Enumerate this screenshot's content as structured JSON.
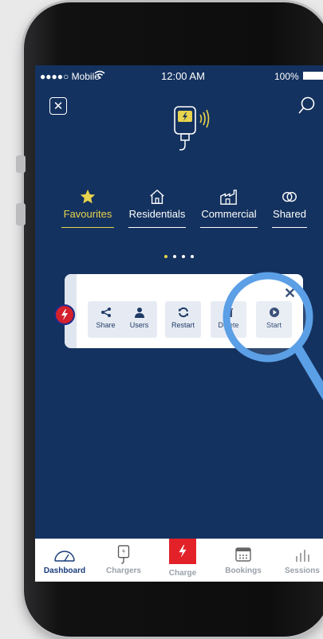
{
  "status_bar": {
    "carrier": "●●●●○ Mobile",
    "time": "12:00 AM",
    "battery": "100%"
  },
  "tabs": [
    {
      "label": "Favourites",
      "icon": "star-icon",
      "active": true
    },
    {
      "label": "Residentials",
      "icon": "house-icon",
      "active": false
    },
    {
      "label": "Commercial",
      "icon": "factory-icon",
      "active": false
    },
    {
      "label": "Shared",
      "icon": "link-icon",
      "active": false
    }
  ],
  "pager": {
    "count": 4,
    "active_index": 0
  },
  "card": {
    "actions": [
      {
        "label": "Share",
        "icon": "share-icon"
      },
      {
        "label": "Users",
        "icon": "user-icon"
      },
      {
        "label": "Restart",
        "icon": "refresh-icon"
      },
      {
        "label": "Delete",
        "icon": "trash-icon"
      },
      {
        "label": "Start",
        "icon": "play-icon"
      }
    ]
  },
  "bottom_nav": [
    {
      "label": "Dashboard",
      "icon": "gauge-icon",
      "active": true
    },
    {
      "label": "Chargers",
      "icon": "charger-icon",
      "active": false
    },
    {
      "label": "Charge",
      "icon": "bolt-icon",
      "active": false
    },
    {
      "label": "Bookings",
      "icon": "calendar-icon",
      "active": false
    },
    {
      "label": "Sessions",
      "icon": "bar-chart-icon",
      "active": false
    }
  ],
  "colors": {
    "background": "#14325f",
    "accent": "#e7d34c",
    "charge_red": "#e32129",
    "nav_active": "#183b7a"
  }
}
